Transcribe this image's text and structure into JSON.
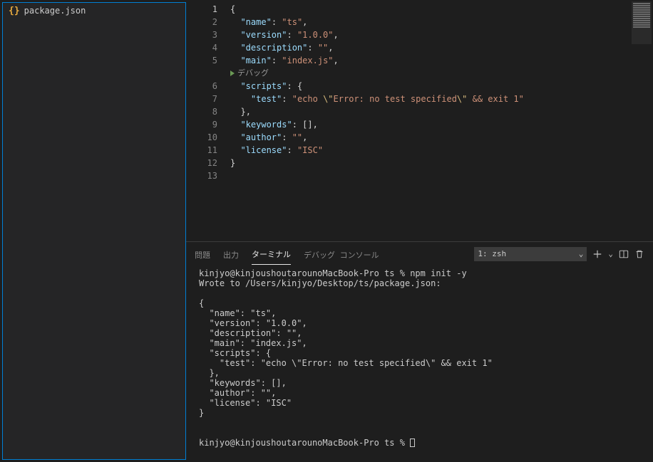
{
  "sidebar": {
    "file": {
      "icon": "{}",
      "label": "package.json"
    }
  },
  "editor": {
    "codelens": "デバッグ",
    "lines": [
      {
        "n": 1,
        "type": "bracket",
        "text": "{",
        "indent": 0
      },
      {
        "n": 2,
        "type": "kv",
        "key": "name",
        "value": "ts",
        "trailingComma": true
      },
      {
        "n": 3,
        "type": "kv",
        "key": "version",
        "value": "1.0.0",
        "trailingComma": true
      },
      {
        "n": 4,
        "type": "kv",
        "key": "description",
        "value": "",
        "trailingComma": true
      },
      {
        "n": 5,
        "type": "kv",
        "key": "main",
        "value": "index.js",
        "trailingComma": true
      },
      {
        "n": 6,
        "type": "kopen",
        "key": "scripts"
      },
      {
        "n": 7,
        "type": "kvesc",
        "key": "test",
        "prefix": "echo ",
        "esc1": "\\\"",
        "mid": "Error: no test specified",
        "esc2": "\\\"",
        "suffix": " && exit 1",
        "indent": 2
      },
      {
        "n": 8,
        "type": "close",
        "trailingComma": true
      },
      {
        "n": 9,
        "type": "karr",
        "key": "keywords",
        "trailingComma": true
      },
      {
        "n": 10,
        "type": "kv",
        "key": "author",
        "value": "",
        "trailingComma": true
      },
      {
        "n": 11,
        "type": "kv",
        "key": "license",
        "value": "ISC",
        "trailingComma": false
      },
      {
        "n": 12,
        "type": "bracket",
        "text": "}",
        "indent": 0
      },
      {
        "n": 13,
        "type": "empty"
      }
    ]
  },
  "panel": {
    "tabs": {
      "problems": "問題",
      "output": "出力",
      "terminal": "ターミナル",
      "debugConsole": "デバッグ コンソール"
    },
    "shellLabel": "1: zsh",
    "terminalText": "kinjyo@kinjoushoutarounoMacBook-Pro ts % npm init -y\nWrote to /Users/kinjyo/Desktop/ts/package.json:\n\n{\n  \"name\": \"ts\",\n  \"version\": \"1.0.0\",\n  \"description\": \"\",\n  \"main\": \"index.js\",\n  \"scripts\": {\n    \"test\": \"echo \\\"Error: no test specified\\\" && exit 1\"\n  },\n  \"keywords\": [],\n  \"author\": \"\",\n  \"license\": \"ISC\"\n}\n\n\nkinjyo@kinjoushoutarounoMacBook-Pro ts % "
  }
}
